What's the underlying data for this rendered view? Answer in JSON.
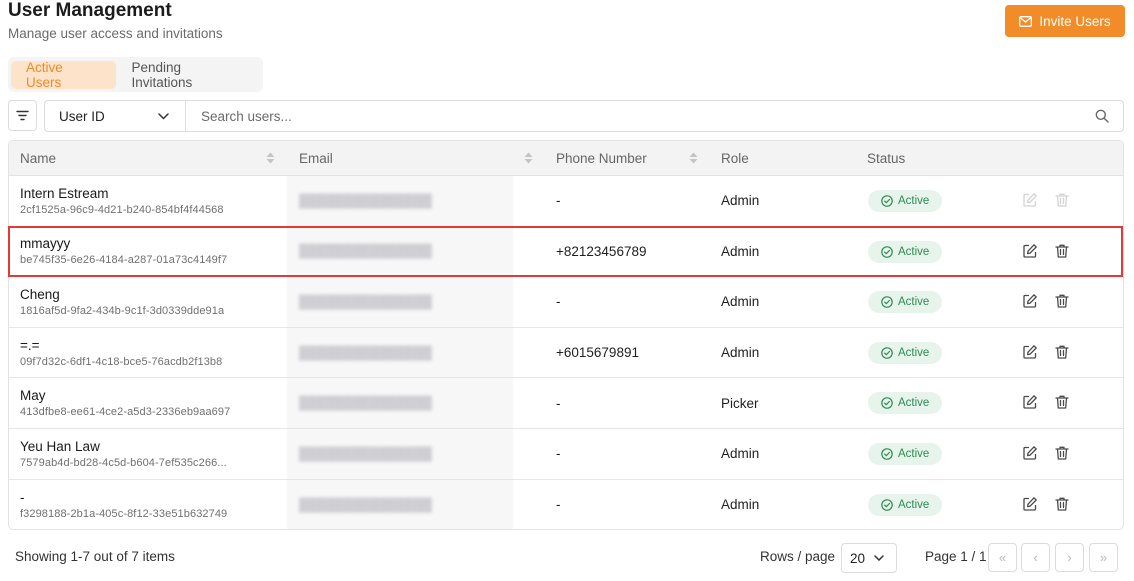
{
  "header": {
    "title": "User Management",
    "subtitle": "Manage user access and invitations",
    "invite_label": "Invite Users"
  },
  "tabs": [
    {
      "label": "Active Users",
      "active": true
    },
    {
      "label": "Pending Invitations",
      "active": false
    }
  ],
  "filter": {
    "selected_field": "User ID",
    "search_placeholder": "Search users...",
    "search_value": ""
  },
  "table": {
    "columns": [
      "Name",
      "Email",
      "Phone Number",
      "Role",
      "Status"
    ],
    "rows": [
      {
        "name": "Intern Estream",
        "id": "2cf1525a-96c9-4d21-b240-854bf4f44568",
        "phone": "-",
        "role": "Admin",
        "status": "Active"
      },
      {
        "name": "mmayyy",
        "id": "be745f35-6e26-4184-a287-01a73c4149f7",
        "phone": "+82123456789",
        "role": "Admin",
        "status": "Active"
      },
      {
        "name": "Cheng",
        "id": "1816af5d-9fa2-434b-9c1f-3d0339dde91a",
        "phone": "-",
        "role": "Admin",
        "status": "Active"
      },
      {
        "name": "=.=",
        "id": "09f7d32c-6df1-4c18-bce5-76acdb2f13b8",
        "phone": "+6015679891",
        "role": "Admin",
        "status": "Active"
      },
      {
        "name": "May",
        "id": "413dfbe8-ee61-4ce2-a5d3-2336eb9aa697",
        "phone": "-",
        "role": "Picker",
        "status": "Active"
      },
      {
        "name": "Yeu Han Law",
        "id": "7579ab4d-bd28-4c5d-b604-7ef535c266...",
        "phone": "-",
        "role": "Admin",
        "status": "Active"
      },
      {
        "name": "-",
        "id": "f3298188-2b1a-405c-8f12-33e51b632749",
        "phone": "-",
        "role": "Admin",
        "status": "Active"
      }
    ]
  },
  "footer": {
    "showing": "Showing 1-7 out of 7 items",
    "rows_per_page_label": "Rows / page",
    "rows_per_page": "20",
    "page_label": "Page 1 / 1"
  },
  "colors": {
    "accent": "#f28c28",
    "accent_light": "#fde3c9",
    "status_active_bg": "#e7f4ec",
    "status_active_fg": "#2f8a53",
    "highlight": "#e53935"
  },
  "icons": [
    "mail-icon",
    "filter-icon",
    "chevron-down-icon",
    "search-icon",
    "sort-icon",
    "check-circle-icon",
    "edit-icon",
    "trash-icon",
    "first-page-icon",
    "prev-page-icon",
    "next-page-icon",
    "last-page-icon"
  ]
}
